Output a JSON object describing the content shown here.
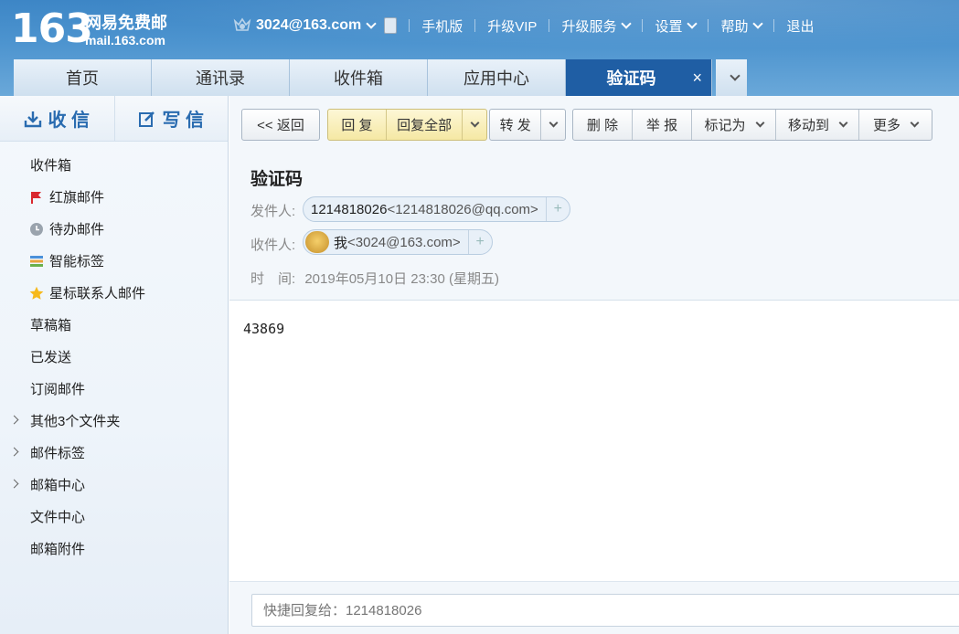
{
  "logo": {
    "number": "163",
    "title": "网易免费邮",
    "domain": "mail.163.com"
  },
  "topbar": {
    "account": "3024@163.com",
    "links": [
      "手机版",
      "升级VIP",
      "升级服务",
      "设置",
      "帮助",
      "退出"
    ]
  },
  "tabs": [
    {
      "label": "首页"
    },
    {
      "label": "通讯录"
    },
    {
      "label": "收件箱"
    },
    {
      "label": "应用中心"
    },
    {
      "label": "验证码",
      "active": true
    }
  ],
  "sidebar": {
    "receive_label": "收 信",
    "compose_label": "写 信",
    "folders": [
      {
        "label": "收件箱"
      },
      {
        "label": "红旗邮件",
        "icon": "red-flag-icon"
      },
      {
        "label": "待办邮件",
        "icon": "clock-icon"
      },
      {
        "label": "智能标签",
        "icon": "tag-stripes-icon"
      },
      {
        "label": "星标联系人邮件",
        "icon": "star-icon"
      },
      {
        "label": "草稿箱"
      },
      {
        "label": "已发送"
      },
      {
        "label": "订阅邮件"
      },
      {
        "label": "其他3个文件夹",
        "expandable": true
      },
      {
        "label": "邮件标签",
        "expandable": true
      },
      {
        "label": "邮箱中心",
        "expandable": true
      },
      {
        "label": "文件中心"
      },
      {
        "label": "邮箱附件"
      }
    ]
  },
  "toolbar": {
    "back": "<< 返回",
    "reply": "回 复",
    "reply_all": "回复全部",
    "forward": "转 发",
    "delete": "删 除",
    "report": "举 报",
    "mark_as": "标记为",
    "move_to": "移动到",
    "more": "更多"
  },
  "mail": {
    "subject": "验证码",
    "from_label": "发件人:",
    "from_name": "1214818026",
    "from_addr": "<1214818026@qq.com>",
    "to_label": "收件人:",
    "to_name": "我",
    "to_addr": "<3024@163.com>",
    "time_label": "时　间:",
    "time_value": "2019年05月10日 23:30 (星期五)",
    "body": "43869"
  },
  "quick_reply": {
    "placeholder": "快捷回复给：1214818026"
  },
  "colors": {
    "header_blue": "#4d94cf",
    "active_tab": "#1f5ea4",
    "reply_yellow": "#f5e8a4",
    "flag_red": "#d9272e",
    "star_yellow": "#f6b91c"
  }
}
